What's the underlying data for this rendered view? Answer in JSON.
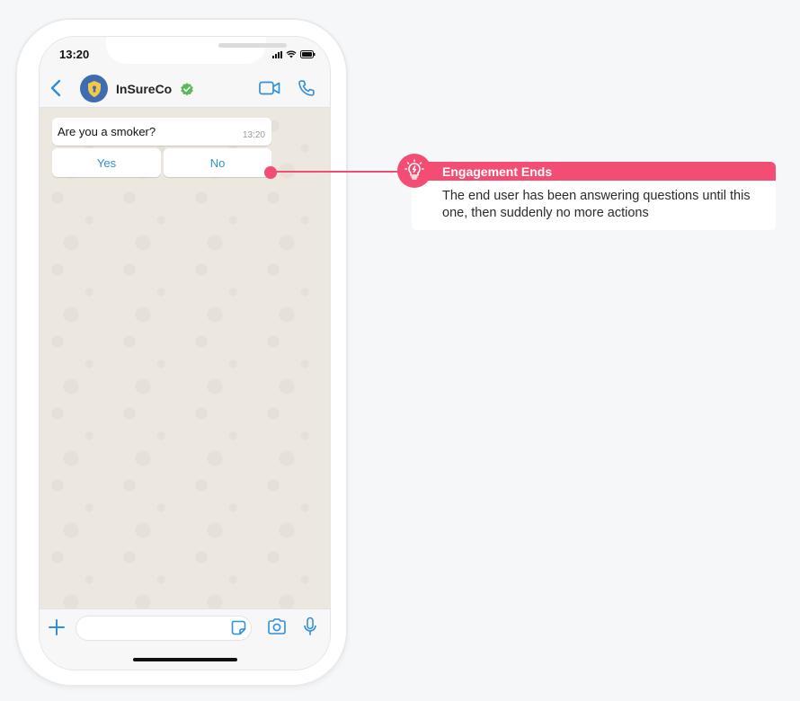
{
  "status_bar": {
    "time": "13:20"
  },
  "header": {
    "contact_name": "InSureCo"
  },
  "chat": {
    "message": {
      "text": "Are you a smoker?",
      "time": "13:20"
    },
    "quick_replies": [
      {
        "label": "Yes"
      },
      {
        "label": "No"
      }
    ]
  },
  "callout": {
    "title": "Engagement Ends",
    "body": "The end user has been answering questions until this one, then suddenly no more actions"
  },
  "colors": {
    "accent": "#f44d73",
    "whatsapp_blue": "#2f8fd8",
    "verified_green": "#5cb85c",
    "avatar_blue": "#3f6cb0"
  },
  "icons": [
    "back-chevron-icon",
    "shield-icon",
    "verified-icon",
    "video-call-icon",
    "phone-call-icon",
    "plus-icon",
    "sticker-icon",
    "camera-icon",
    "microphone-icon",
    "lightbulb-icon"
  ]
}
